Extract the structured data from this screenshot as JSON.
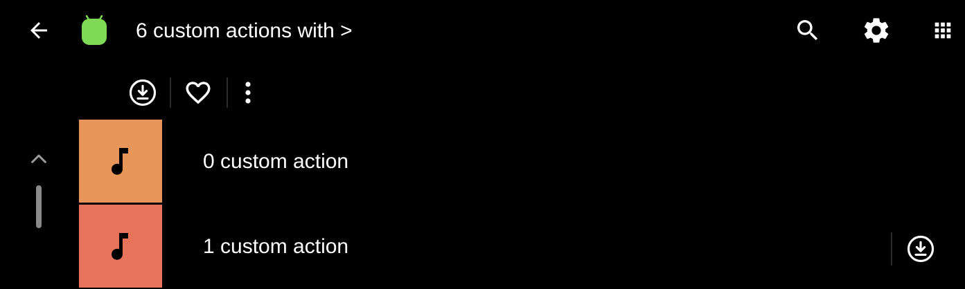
{
  "header": {
    "title": "6 custom actions with >",
    "icons": {
      "back": "arrow-back-icon",
      "app": "android-app-icon",
      "search": "search-icon",
      "settings": "gear-icon",
      "apps": "apps-grid-icon"
    }
  },
  "toolbar": {
    "icons": [
      "download-circle-icon",
      "heart-outline-icon",
      "more-vert-icon"
    ]
  },
  "list": {
    "items": [
      {
        "label": "0 custom action",
        "thumb_color": "#E8955A",
        "icon": "music-note-icon",
        "has_download": false
      },
      {
        "label": "1 custom action",
        "thumb_color": "#E6735A",
        "icon": "music-note-icon",
        "has_download": true
      }
    ]
  },
  "colors": {
    "background": "#000000",
    "text": "#FFFFFF",
    "app_icon": "#7ED957",
    "scrollbar": "#8A8A8A",
    "scroll_chevron": "#9E9E9E"
  }
}
